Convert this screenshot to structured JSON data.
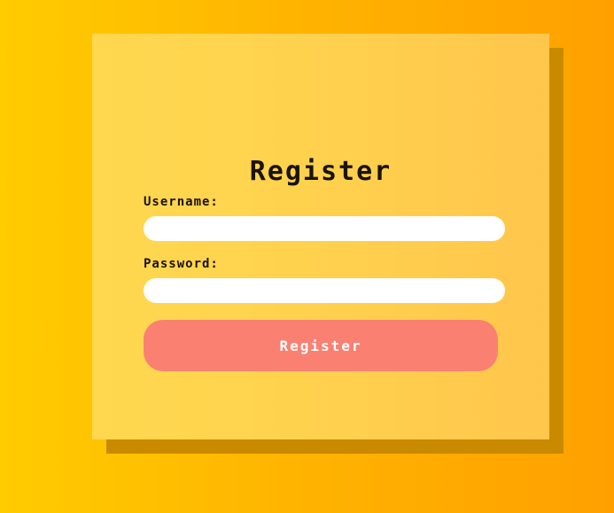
{
  "form": {
    "title": "Register",
    "username_label": "Username:",
    "username_value": "",
    "password_label": "Password:",
    "password_value": "",
    "submit_label": "Register"
  },
  "colors": {
    "background_start": "#ffcc00",
    "background_end": "#ffa000",
    "card": "#ffd24e",
    "card_shadow": "#c98a00",
    "button": "#fa8072",
    "button_text": "#ffffff",
    "text": "#1a1308"
  }
}
